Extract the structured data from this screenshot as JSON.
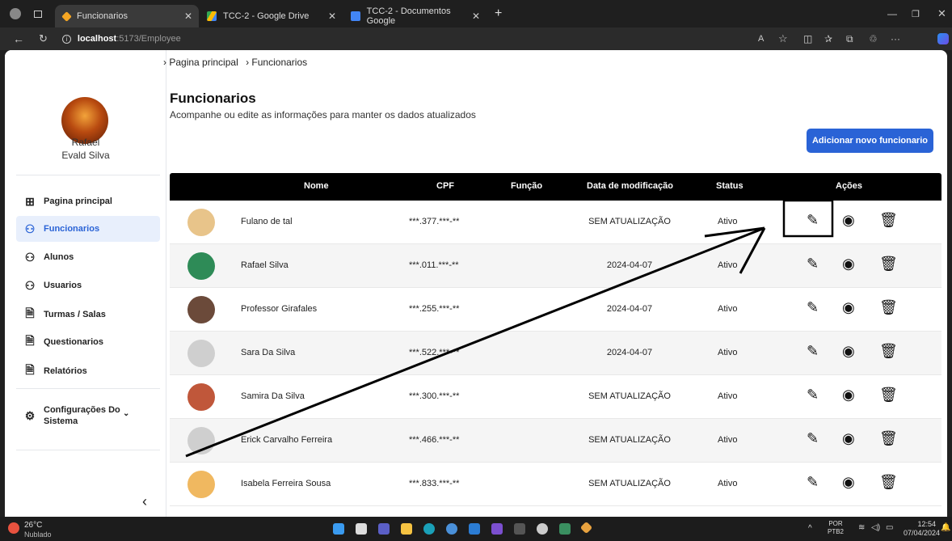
{
  "browser": {
    "tabs": [
      {
        "label": "Funcionarios",
        "icon": "app-icon",
        "color": "#f5a623"
      },
      {
        "label": "TCC-2 - Google Drive",
        "icon": "google-drive-icon",
        "color": "#34a853"
      },
      {
        "label": "TCC-2 - Documentos Google",
        "icon": "google-docs-icon",
        "color": "#4285f4"
      }
    ],
    "url_host": "localhost",
    "url_path": ":5173/Employee"
  },
  "sidebar": {
    "user_first": "Rafael",
    "user_last": "Evald Silva",
    "items": [
      {
        "label": "Pagina principal",
        "icon": "grid-icon",
        "glyph": "⊞",
        "active": false
      },
      {
        "label": "Funcionarios",
        "icon": "user-icon",
        "glyph": "♂",
        "active": true
      },
      {
        "label": "Alunos",
        "icon": "user-icon",
        "glyph": "♂",
        "active": false
      },
      {
        "label": "Usuarios",
        "icon": "user-icon",
        "glyph": "♂",
        "active": false
      },
      {
        "label": "Turmas / Salas",
        "icon": "document-icon",
        "glyph": "☰",
        "active": false
      },
      {
        "label": "Questionarios",
        "icon": "document-icon",
        "glyph": "☰",
        "active": false
      },
      {
        "label": "Relatórios",
        "icon": "document-icon",
        "glyph": "☰",
        "active": false
      }
    ],
    "settings_label_1": "Configurações Do",
    "settings_label_2": "Sistema"
  },
  "breadcrumb": {
    "item1": "Pagina principal",
    "item2": "Funcionarios"
  },
  "header": {
    "title": "Funcionarios",
    "subtitle": "Acompanhe ou edite as informações para manter os dados atualizados",
    "add_button": "Adicionar novo funcionario"
  },
  "table": {
    "columns": {
      "name": "Nome",
      "cpf": "CPF",
      "role": "Função",
      "modified": "Data de modificação",
      "status": "Status",
      "actions": "Ações"
    },
    "rows": [
      {
        "name": "Fulano de tal",
        "cpf": "***.377.***-**",
        "role": "",
        "modified": "SEM ATUALIZAÇÃO",
        "status": "Ativo",
        "avatar_color": "#e8c48a"
      },
      {
        "name": "Rafael Silva",
        "cpf": "***.011.***-**",
        "role": "",
        "modified": "2024-04-07",
        "status": "Ativo",
        "avatar_color": "#2e8b57"
      },
      {
        "name": "Professor Girafales",
        "cpf": "***.255.***-**",
        "role": "",
        "modified": "2024-04-07",
        "status": "Ativo",
        "avatar_color": "#6b4a3a"
      },
      {
        "name": "Sara Da Silva",
        "cpf": "***.522.***-**",
        "role": "",
        "modified": "2024-04-07",
        "status": "Ativo",
        "avatar_color": "#cfcfcf"
      },
      {
        "name": "Samira Da Silva",
        "cpf": "***.300.***-**",
        "role": "",
        "modified": "SEM ATUALIZAÇÃO",
        "status": "Ativo",
        "avatar_color": "#c0573a"
      },
      {
        "name": "Erick Carvalho Ferreira",
        "cpf": "***.466.***-**",
        "role": "",
        "modified": "SEM ATUALIZAÇÃO",
        "status": "Ativo",
        "avatar_color": "#cfcfcf"
      },
      {
        "name": "Isabela Ferreira Sousa",
        "cpf": "***.833.***-**",
        "role": "",
        "modified": "SEM ATUALIZAÇÃO",
        "status": "Ativo",
        "avatar_color": "#f0b860"
      }
    ]
  },
  "taskbar": {
    "weather_temp": "26°C",
    "weather_desc": "Nublado",
    "lang_1": "POR",
    "lang_2": "PTB2",
    "time": "12:54",
    "date": "07/04/2024"
  }
}
